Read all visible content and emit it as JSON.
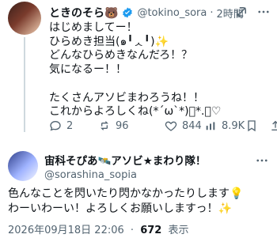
{
  "post": {
    "display_name": "ときのそら🐻",
    "handle": "@tokino_sora",
    "time": "2時間",
    "text": "はじめましてー！\nひらめき担当(๑╹ᆺ╹)✨\nどんなひらめきなんだろ！？\n気になるー！！\n\nたくさんアソビまわろうね！！\nこれからよろしくね(*´ω`*)ﾟ*.・♡",
    "actions": {
      "replies": "2",
      "reposts": "96",
      "likes": "844",
      "views": "8.9K"
    }
  },
  "reply": {
    "display_name": "宙科そぴあ🛰️アソビ★まわり隊！",
    "handle": "@sorashina_sopia",
    "text": "色んなことを閃いたり閃かなかったりします💡\nわーいわーい！よろしくお願いしますっ！✨",
    "date": "2026年09月18日 22:06",
    "separator": "·",
    "views": "672",
    "views_label": "表示"
  },
  "icons": {
    "verified": "verified-badge-icon",
    "grok": "grok-icon",
    "more": "more-icon",
    "reply": "reply-icon",
    "repost": "repost-icon",
    "like": "like-icon",
    "views": "views-icon",
    "bookmark": "bookmark-icon",
    "share": "share-icon"
  },
  "colors": {
    "text": "#0f1419",
    "secondary": "#536471",
    "verified": "#1d9bf0",
    "divider": "#cfd9de"
  }
}
